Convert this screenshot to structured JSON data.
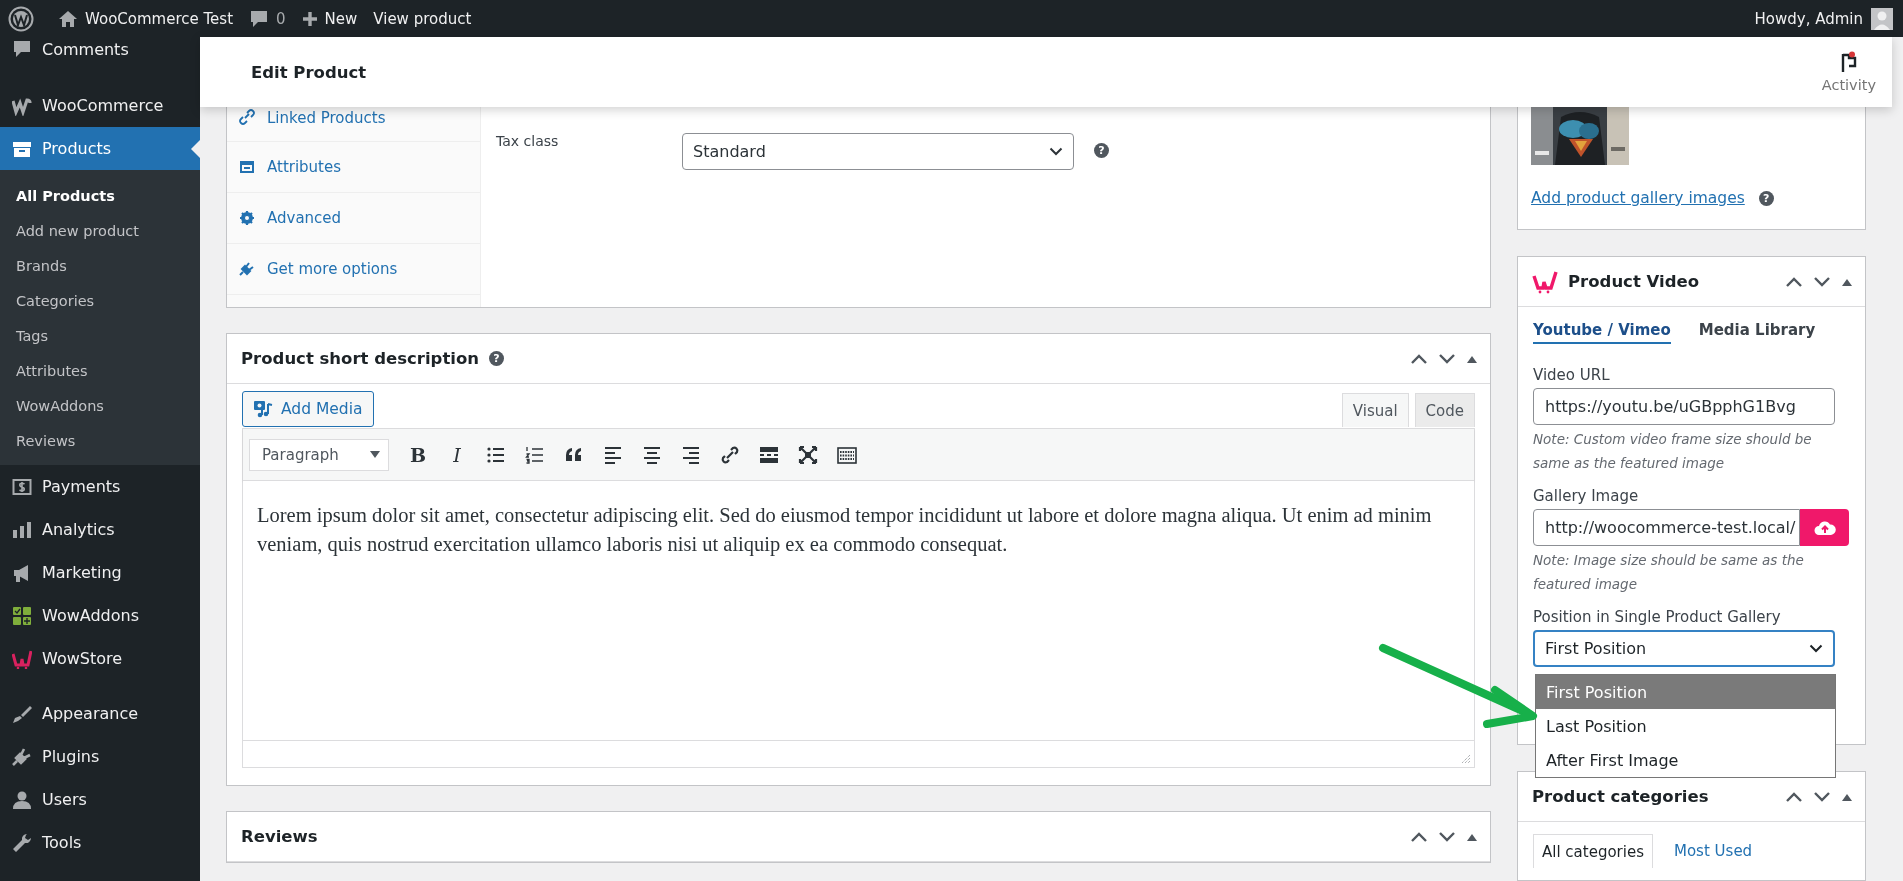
{
  "admin_bar": {
    "site": "WooCommerce Test",
    "comments": "0",
    "new": "New",
    "view": "View product",
    "greeting": "Howdy, Admin"
  },
  "sidebar": {
    "groups": [
      {
        "items": [
          {
            "label": "Comments",
            "selected": false
          }
        ]
      },
      {
        "items": [
          {
            "label": "WooCommerce",
            "selected": false
          },
          {
            "label": "Products",
            "selected": true,
            "submenu": [
              {
                "label": "All Products",
                "selected": true
              },
              {
                "label": "Add new product",
                "selected": false
              },
              {
                "label": "Brands",
                "selected": false
              },
              {
                "label": "Categories",
                "selected": false
              },
              {
                "label": "Tags",
                "selected": false
              },
              {
                "label": "Attributes",
                "selected": false
              },
              {
                "label": "WowAddons",
                "selected": false
              },
              {
                "label": "Reviews",
                "selected": false
              }
            ]
          },
          {
            "label": "Payments",
            "selected": false
          },
          {
            "label": "Analytics",
            "selected": false
          },
          {
            "label": "Marketing",
            "selected": false
          },
          {
            "label": "WowAddons",
            "selected": false
          },
          {
            "label": "WowStore",
            "selected": false
          }
        ]
      },
      {
        "items": [
          {
            "label": "Appearance",
            "selected": false
          },
          {
            "label": "Plugins",
            "selected": false
          },
          {
            "label": "Users",
            "selected": false
          },
          {
            "label": "Tools",
            "selected": false
          }
        ]
      }
    ]
  },
  "header": {
    "title": "Edit Product",
    "activity": "Activity"
  },
  "product_data": {
    "tabs": [
      {
        "label": "Linked Products",
        "selected": false
      },
      {
        "label": "Attributes",
        "selected": false
      },
      {
        "label": "Advanced",
        "selected": false
      },
      {
        "label": "Get more options",
        "selected": false
      }
    ],
    "fields": [
      {
        "label": "Tax class",
        "value": "Standard",
        "help": "?"
      }
    ]
  },
  "short_description": {
    "title": "Product short description",
    "help": "?",
    "add_media": "Add Media",
    "editor_tabs": [
      {
        "label": "Visual",
        "selected": true
      },
      {
        "label": "Code",
        "selected": false
      }
    ],
    "toolbar": [
      {
        "kind": "select",
        "label": "Paragraph"
      },
      {
        "kind": "text",
        "label": "B"
      },
      {
        "kind": "italic",
        "label": "I"
      },
      {
        "kind": "icon"
      },
      {
        "kind": "icon"
      },
      {
        "kind": "icon"
      },
      {
        "kind": "icon"
      },
      {
        "kind": "icon"
      },
      {
        "kind": "icon"
      },
      {
        "kind": "icon"
      },
      {
        "kind": "icon"
      },
      {
        "kind": "icon"
      },
      {
        "kind": "icon"
      }
    ],
    "content": "Lorem ipsum dolor sit amet, consectetur adipiscing elit. Sed do eiusmod tempor incididunt ut labore et dolore magna aliqua. Ut enim ad minim veniam, quis nostrud exercitation ullamco laboris nisi ut aliquip ex ea commodo consequat."
  },
  "reviews": {
    "title": "Reviews"
  },
  "gallery": {
    "link": "Add product gallery images",
    "help": "?"
  },
  "product_video": {
    "title": "Product Video",
    "tabs": [
      {
        "label": "Youtube / Vimeo",
        "selected": true
      },
      {
        "label": "Media Library",
        "selected": false
      }
    ],
    "fields": [
      {
        "kind": "text",
        "label": "Video URL",
        "value": "https://youtu.be/uGBpphG1Bvg",
        "note": "Note: Custom video frame size should be same as the featured image"
      },
      {
        "kind": "upload",
        "label": "Gallery Image",
        "value": "http://woocommerce-test.local/",
        "note": "Note: Image size should be same as the featured image"
      },
      {
        "kind": "select",
        "label": "Position in Single Product Gallery",
        "value": "First Position",
        "expanded": true,
        "options": [
          {
            "label": "First Position",
            "selected": true
          },
          {
            "label": "Last Position",
            "selected": false
          },
          {
            "label": "After First Image",
            "selected": false
          }
        ]
      }
    ]
  },
  "product_categories": {
    "title": "Product categories",
    "tabs": [
      {
        "label": "All categories",
        "selected": true
      },
      {
        "label": "Most Used",
        "selected": false
      }
    ]
  }
}
